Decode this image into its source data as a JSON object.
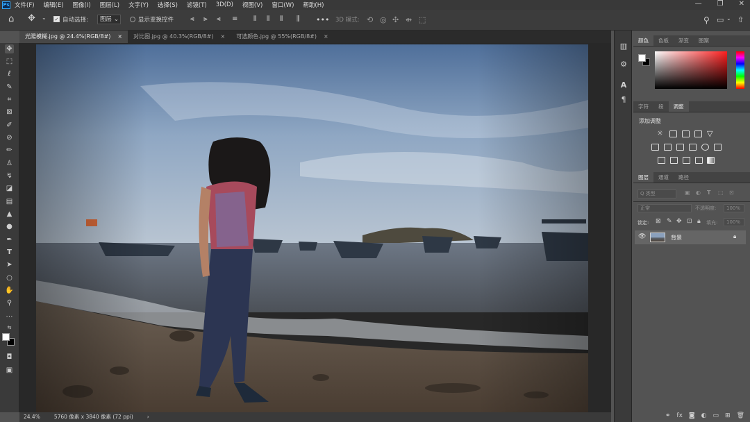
{
  "menubar": {
    "logo": "Ps",
    "items": [
      "文件(F)",
      "编辑(E)",
      "图像(I)",
      "图层(L)",
      "文字(Y)",
      "选择(S)",
      "滤镜(T)",
      "3D(D)",
      "视图(V)",
      "窗口(W)",
      "帮助(H)"
    ]
  },
  "options": {
    "auto_select_label": "自动选择:",
    "auto_select_checked": true,
    "auto_select_target": "图层",
    "show_transform_label": "显示变换控件",
    "mode_3d_label": "3D 模式:"
  },
  "doc_tabs": [
    {
      "label": "光陽模糊.jpg @ 24.4%(RGB/8#)",
      "close": "×",
      "active": true
    },
    {
      "label": "对比图.jpg @ 40.3%(RGB/8#)",
      "close": "×",
      "active": false
    },
    {
      "label": "可选颜色.jpg @ 55%(RGB/8#)",
      "close": "×",
      "active": false
    }
  ],
  "status": {
    "zoom": "24.4%",
    "dimensions": "5760 像素 x 3840 像素 (72 ppi)",
    "arrow": "›"
  },
  "panels": {
    "color_tabs": [
      "颜色",
      "色板",
      "渐变",
      "图案"
    ],
    "props_tabs": [
      "字符",
      "段",
      "调整"
    ],
    "adjust_title": "添加调整",
    "layer_tabs": [
      "图层",
      "通道",
      "路径"
    ],
    "layer_filter_placeholder": "Q 类型",
    "blend_mode": "正常",
    "opacity_label": "不透明度:",
    "opacity_value": "100%",
    "lock_label": "锁定:",
    "fill_label": "填充:",
    "fill_value": "100%",
    "layer_name": "背景"
  },
  "colors": {
    "accent": "#31a8ff",
    "fg_swatch": "#ffffff",
    "bg_swatch": "#000000"
  }
}
